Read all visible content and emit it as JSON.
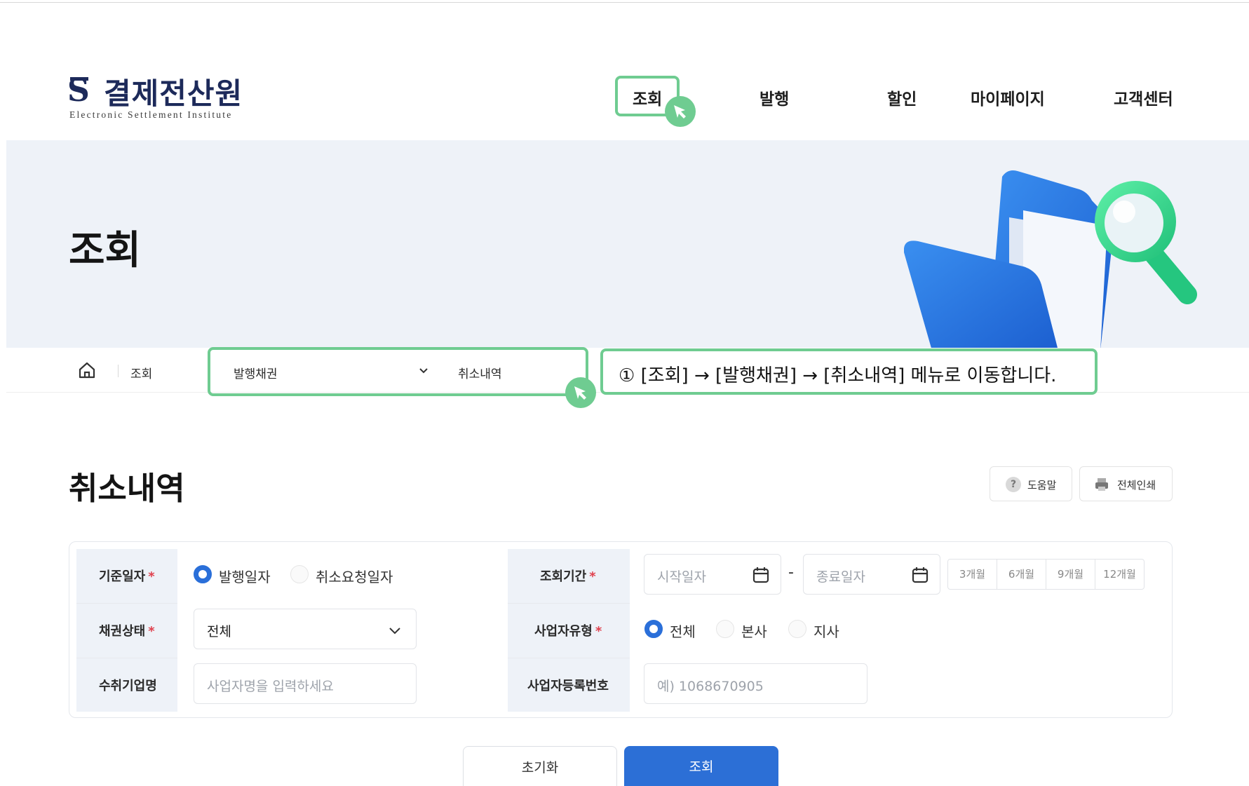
{
  "header": {
    "logo_kr": "결제전산원",
    "logo_en": "Electronic Settlement Institute",
    "nav": [
      "조회",
      "발행",
      "할인",
      "마이페이지",
      "고객센터"
    ]
  },
  "banner": {
    "title": "조회"
  },
  "breadcrumb": {
    "home_label": "조회",
    "level1": "발행채권",
    "level2": "취소내역"
  },
  "callout": {
    "text": "① [조회] → [발행채권] → [취소내역] 메뉴로 이동합니다."
  },
  "section": {
    "title": "취소내역",
    "help_label": "도움말",
    "print_label": "전체인쇄"
  },
  "form": {
    "base_date": {
      "label": "기준일자",
      "required_mark": "*",
      "options": [
        "발행일자",
        "취소요청일자"
      ],
      "selected": "발행일자"
    },
    "period": {
      "label": "조회기간",
      "required_mark": "*",
      "start_placeholder": "시작일자",
      "end_placeholder": "종료일자",
      "separator": "-",
      "quick": [
        "3개월",
        "6개월",
        "9개월",
        "12개월"
      ]
    },
    "bond_status": {
      "label": "채권상태",
      "required_mark": "*",
      "value": "전체"
    },
    "biz_type": {
      "label": "사업자유형",
      "required_mark": "*",
      "options": [
        "전체",
        "본사",
        "지사"
      ],
      "selected": "전체"
    },
    "company": {
      "label": "수취기업명",
      "placeholder": "사업자명을 입력하세요"
    },
    "biz_no": {
      "label": "사업자등록번호",
      "placeholder": "예) 1068670905"
    }
  },
  "buttons": {
    "reset": "초기화",
    "search": "조회"
  },
  "colors": {
    "highlight": "#6fcc91",
    "primary": "#2c6fd6",
    "banner_bg": "#eef2f8",
    "required": "#e0414e"
  }
}
